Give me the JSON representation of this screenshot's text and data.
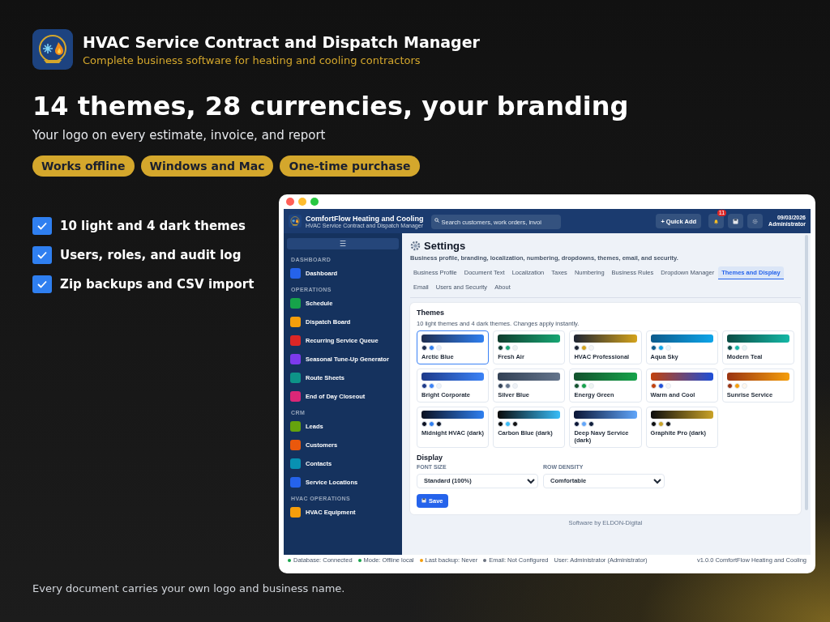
{
  "promo": {
    "title": "HVAC Service Contract and Dispatch Manager",
    "tagline": "Complete business software for heating and cooling contractors",
    "headline": "14 themes, 28 currencies, your branding",
    "subheadline": "Your logo on every estimate, invoice, and report",
    "pills": [
      "Works offline",
      "Windows and Mac",
      "One-time purchase"
    ],
    "features": [
      "10 light and 4 dark themes",
      "Users, roles, and audit log",
      "Zip backups and CSV import"
    ],
    "footer_note": "Every document carries your own logo and business name."
  },
  "app": {
    "brand": {
      "name": "ComfortFlow Heating and Cooling",
      "subtitle": "HVAC Service Contract and Dispatch Manager"
    },
    "search": {
      "placeholder": "Search customers, work orders, invoi"
    },
    "quick_add": "+ Quick Add",
    "notification_count": "11",
    "date": "09/03/2026",
    "user": "Administrator",
    "sidebar": {
      "menu": "☰",
      "sections": [
        {
          "title": "DASHBOARD",
          "items": [
            {
              "label": "Dashboard",
              "color": "#2563eb"
            }
          ]
        },
        {
          "title": "OPERATIONS",
          "items": [
            {
              "label": "Schedule",
              "color": "#16a34a"
            },
            {
              "label": "Dispatch Board",
              "color": "#f59e0b"
            },
            {
              "label": "Recurring Service Queue",
              "color": "#dc2626"
            },
            {
              "label": "Seasonal Tune-Up Generator",
              "color": "#7c3aed"
            },
            {
              "label": "Route Sheets",
              "color": "#0d9488"
            },
            {
              "label": "End of Day Closeout",
              "color": "#db2777"
            }
          ]
        },
        {
          "title": "CRM",
          "items": [
            {
              "label": "Leads",
              "color": "#65a30d"
            },
            {
              "label": "Customers",
              "color": "#ea580c"
            },
            {
              "label": "Contacts",
              "color": "#0891b2"
            },
            {
              "label": "Service Locations",
              "color": "#2563eb"
            }
          ]
        },
        {
          "title": "HVAC OPERATIONS",
          "items": [
            {
              "label": "HVAC Equipment",
              "color": "#f59e0b"
            }
          ]
        }
      ]
    },
    "settings": {
      "title": "Settings",
      "description": "Business profile, branding, localization, numbering, dropdowns, themes, email, and security.",
      "tabs": [
        {
          "label": "Business Profile",
          "selected": false
        },
        {
          "label": "Document Text",
          "selected": false
        },
        {
          "label": "Localization",
          "selected": false
        },
        {
          "label": "Taxes",
          "selected": false
        },
        {
          "label": "Numbering",
          "selected": false
        },
        {
          "label": "Business Rules",
          "selected": false
        },
        {
          "label": "Dropdown Manager",
          "selected": false
        },
        {
          "label": "Themes and Display",
          "selected": true
        },
        {
          "label": "Email",
          "selected": false
        },
        {
          "label": "Users and Security",
          "selected": false
        },
        {
          "label": "About",
          "selected": false
        }
      ],
      "themes": {
        "title": "Themes",
        "note": "10 light themes and 4 dark themes. Changes apply instantly.",
        "items": [
          {
            "name": "Arctic Blue",
            "selected": true,
            "swatches": [
              {
                "color": "#1e2d4f"
              },
              {
                "color": "#2f7ff0"
              },
              {
                "color": "#e8eef8"
              }
            ]
          },
          {
            "name": "Fresh Air",
            "selected": false,
            "swatches": [
              {
                "color": "#0f3d2e"
              },
              {
                "color": "#17a673"
              },
              {
                "color": "#eef2f0"
              }
            ]
          },
          {
            "name": "HVAC Professional",
            "selected": false,
            "swatches": [
              {
                "color": "#1e2433"
              },
              {
                "color": "#d4a31c"
              },
              {
                "color": "#f5f5f5"
              }
            ]
          },
          {
            "name": "Aqua Sky",
            "selected": false,
            "swatches": [
              {
                "color": "#0b5a8c"
              },
              {
                "color": "#0ea5e9"
              },
              {
                "color": "#eaf6fc"
              }
            ]
          },
          {
            "name": "Modern Teal",
            "selected": false,
            "swatches": [
              {
                "color": "#0b4d45"
              },
              {
                "color": "#14b8a6"
              },
              {
                "color": "#e6f7f5"
              }
            ]
          },
          {
            "name": "Bright Corporate",
            "selected": false,
            "swatches": [
              {
                "color": "#1e3a8a"
              },
              {
                "color": "#3b82f6"
              },
              {
                "color": "#eef2f8"
              }
            ]
          },
          {
            "name": "Silver Blue",
            "selected": false,
            "swatches": [
              {
                "color": "#334155"
              },
              {
                "color": "#64748b"
              },
              {
                "color": "#eef1f5"
              }
            ]
          },
          {
            "name": "Energy Green",
            "selected": false,
            "swatches": [
              {
                "color": "#14532d"
              },
              {
                "color": "#16a34a"
              },
              {
                "color": "#eef5f0"
              }
            ]
          },
          {
            "name": "Warm and Cool",
            "selected": false,
            "swatches": [
              {
                "color": "#c2410c"
              },
              {
                "color": "#1d4ed8"
              },
              {
                "color": "#f5f5f5"
              }
            ]
          },
          {
            "name": "Sunrise Service",
            "selected": false,
            "swatches": [
              {
                "color": "#9a3412"
              },
              {
                "color": "#f59e0b"
              },
              {
                "color": "#fff7ed"
              }
            ]
          },
          {
            "name": "Midnight HVAC (dark)",
            "selected": false,
            "swatches": [
              {
                "color": "#0b1020"
              },
              {
                "color": "#2f7ff0"
              },
              {
                "color": "#111827"
              }
            ]
          },
          {
            "name": "Carbon Blue (dark)",
            "selected": false,
            "swatches": [
              {
                "color": "#0a0a0a"
              },
              {
                "color": "#38bdf8"
              },
              {
                "color": "#111111"
              }
            ]
          },
          {
            "name": "Deep Navy Service (dark)",
            "selected": false,
            "swatches": [
              {
                "color": "#0b1535"
              },
              {
                "color": "#60a5fa"
              },
              {
                "color": "#0f1d3a"
              }
            ]
          },
          {
            "name": "Graphite Pro (dark)",
            "selected": false,
            "swatches": [
              {
                "color": "#0d0d0d"
              },
              {
                "color": "#c9a227"
              },
              {
                "color": "#1a1a1a"
              }
            ]
          }
        ]
      },
      "display": {
        "title": "Display",
        "font_size": {
          "label": "FONT SIZE",
          "value": "Standard (100%)"
        },
        "row_density": {
          "label": "ROW DENSITY",
          "value": "Comfortable"
        }
      },
      "save": "Save",
      "credit": "Software by ELDON-Digital"
    },
    "status_bar": {
      "items": [
        {
          "text": "Database: Connected",
          "color": "#16a34a"
        },
        {
          "text": "Mode: Offline local",
          "color": "#16a34a"
        },
        {
          "text": "Last backup: Never",
          "color": "#f59e0b"
        },
        {
          "text": "Email: Not Configured",
          "color": "#6b7280"
        }
      ],
      "user": "User: Administrator (Administrator)",
      "version": "v1.0.0 ComfortFlow Heating and Cooling"
    }
  }
}
